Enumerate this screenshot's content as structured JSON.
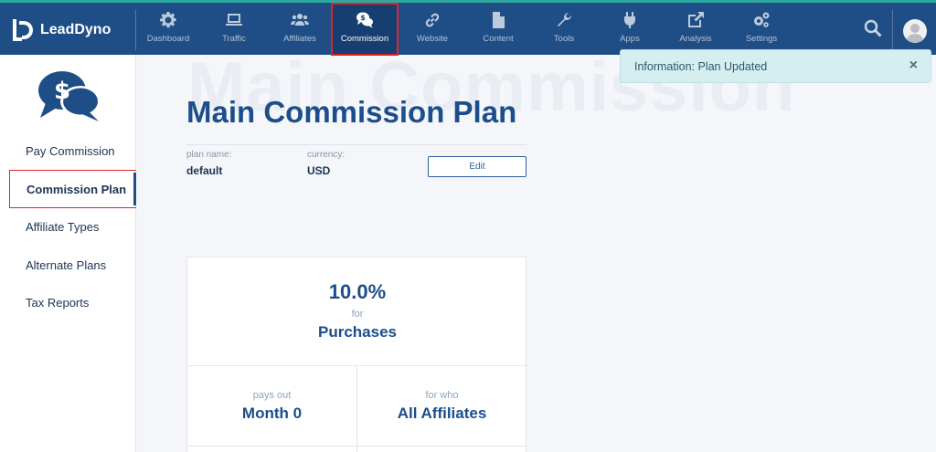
{
  "app": {
    "name": "LeadDyno"
  },
  "nav": [
    {
      "label": "Dashboard",
      "icon": "gear-icon"
    },
    {
      "label": "Traffic",
      "icon": "laptop-icon"
    },
    {
      "label": "Affiliates",
      "icon": "users-icon"
    },
    {
      "label": "Commission",
      "icon": "commission-chat-icon",
      "active": true
    },
    {
      "label": "Website",
      "icon": "link-icon"
    },
    {
      "label": "Content",
      "icon": "file-icon"
    },
    {
      "label": "Tools",
      "icon": "wrench-icon"
    },
    {
      "label": "Apps",
      "icon": "plug-icon"
    },
    {
      "label": "Analysis",
      "icon": "external-link-icon"
    },
    {
      "label": "Settings",
      "icon": "cogs-icon"
    }
  ],
  "sidebar": {
    "icon": "commission-chat-icon",
    "items": [
      {
        "label": "Pay Commission"
      },
      {
        "label": "Commission Plan",
        "active": true
      },
      {
        "label": "Affiliate Types"
      },
      {
        "label": "Alternate Plans"
      },
      {
        "label": "Tax Reports"
      }
    ]
  },
  "main": {
    "watermark": "Main Commission",
    "title": "Main Commission Plan",
    "plan_name_label": "plan name:",
    "plan_name": "default",
    "currency_label": "currency:",
    "currency": "USD",
    "edit_label": "Edit"
  },
  "toast": {
    "message": "Information: Plan Updated",
    "close": "×"
  },
  "commission_card": {
    "rate": "10.0%",
    "for_label": "for",
    "event": "Purchases",
    "pays_out_label": "pays out",
    "pays_out": "Month 0",
    "for_who_label": "for who",
    "for_who": "All Affiliates"
  },
  "colors": {
    "nav_bg": "#1f4d86",
    "accent_teal": "#2fa8a0",
    "highlight_red": "#e0242b",
    "title_blue": "#1b4e8a",
    "toast_bg": "#d5eef0"
  }
}
